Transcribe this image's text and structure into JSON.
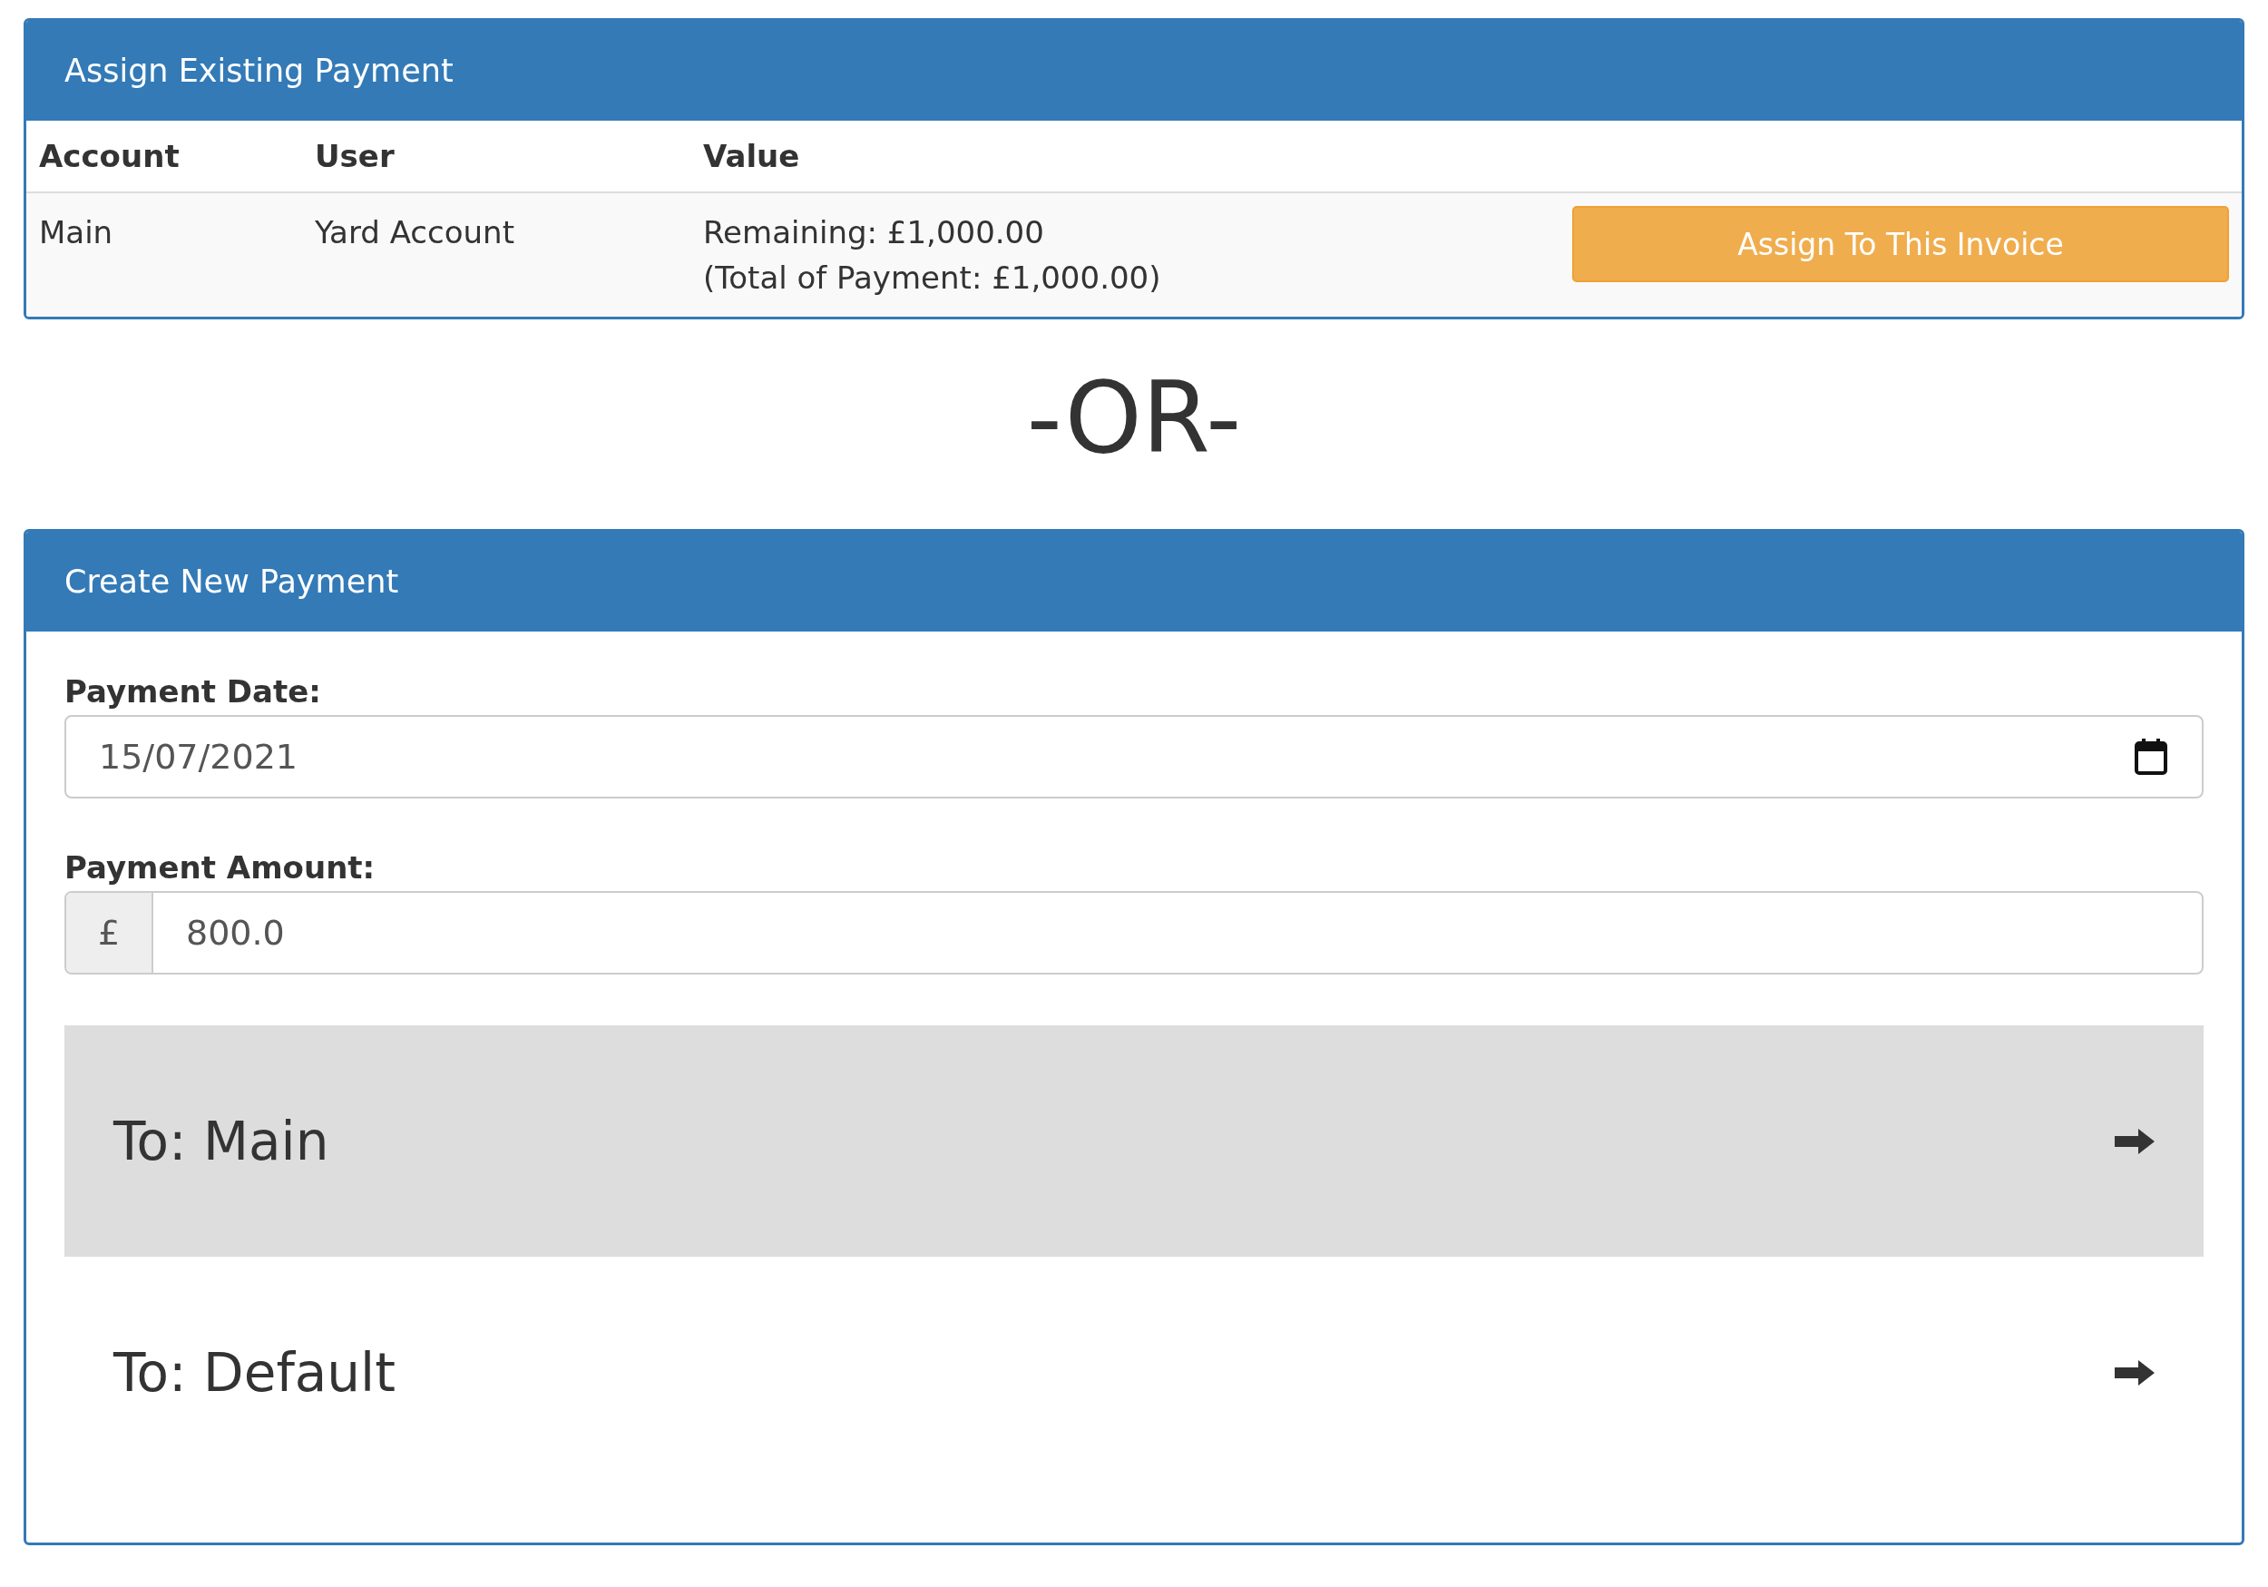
{
  "existing_payment": {
    "title": "Assign Existing Payment",
    "columns": [
      "Account",
      "User",
      "Value"
    ],
    "rows": [
      {
        "account": "Main",
        "user": "Yard Account",
        "remaining": "Remaining: £1,000.00",
        "total": "(Total of Payment: £1,000.00)",
        "action": "Assign To This Invoice"
      }
    ]
  },
  "separator": "-OR-",
  "new_payment": {
    "title": "Create New Payment",
    "date_label": "Payment Date:",
    "date_value": "15/07/2021",
    "amount_label": "Payment Amount:",
    "currency": "£",
    "amount_value": "800.0",
    "accounts": [
      {
        "label": "To: Main",
        "selected": true
      },
      {
        "label": "To: Default",
        "selected": false
      }
    ]
  }
}
